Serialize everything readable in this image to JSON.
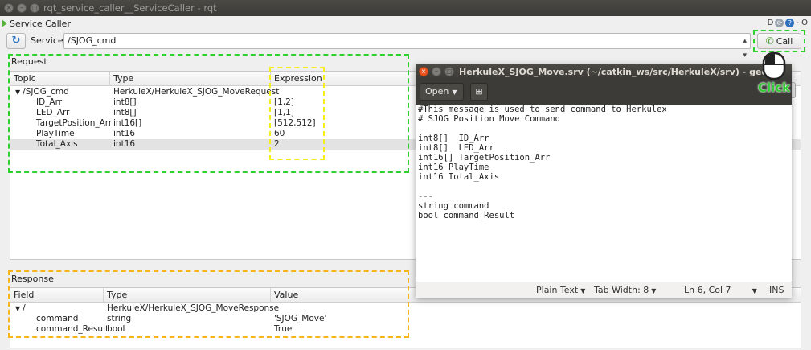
{
  "rqt": {
    "window_title": "rqt_service_caller__ServiceCaller - rqt",
    "dock_title": "Service Caller",
    "dock_controls": [
      "D",
      "O",
      "- O"
    ],
    "service_label": "Service",
    "service_value": "/SJOG_cmd",
    "call_label": "Call"
  },
  "request": {
    "title": "Request",
    "headers": [
      "Topic",
      "Type",
      "Expression"
    ],
    "root": {
      "topic": "/SJOG_cmd",
      "type": "HerkuleX/HerkuleX_SJOG_MoveRequest",
      "expression": ""
    },
    "rows": [
      {
        "topic": "ID_Arr",
        "type": "int8[]",
        "expression": "[1,2]"
      },
      {
        "topic": "LED_Arr",
        "type": "int8[]",
        "expression": "[1,1]"
      },
      {
        "topic": "TargetPosition_Arr",
        "type": "int16[]",
        "expression": "[512,512]"
      },
      {
        "topic": "PlayTime",
        "type": "int16",
        "expression": "60"
      },
      {
        "topic": "Total_Axis",
        "type": "int16",
        "expression": "2"
      }
    ]
  },
  "response": {
    "title": "Response",
    "headers": [
      "Field",
      "Type",
      "Value"
    ],
    "root": {
      "field": "/",
      "type": "HerkuleX/HerkuleX_SJOG_MoveResponse",
      "value": ""
    },
    "rows": [
      {
        "field": "command",
        "type": "string",
        "value": "'SJOG_Move'"
      },
      {
        "field": "command_Result",
        "type": "bool",
        "value": "True"
      }
    ]
  },
  "gedit": {
    "title": "HerkuleX_SJOG_Move.srv (~/catkin_ws/src/HerkuleX/srv) - gedit",
    "open_label": "Open",
    "lines": [
      "#This message is used to send command to Herkulex",
      "# SJOG Position Move Command",
      "",
      "int8[]  ID_Arr",
      "int8[]  LED_Arr",
      "int16[] TargetPosition_Arr",
      "int16 PlayTime",
      "int16 Total_Axis",
      "",
      "---",
      "string command",
      "bool command_Result"
    ],
    "status": {
      "syntax": "Plain Text",
      "tab_width": "Tab Width: 8",
      "position": "Ln 6, Col 7",
      "mode": "INS"
    }
  },
  "annotation": {
    "click_label": "Click"
  },
  "colors": {
    "green": "#2fd12f",
    "yellow": "#f5ee19",
    "orange": "#f7b51a",
    "titlebar": "#3c3b37"
  }
}
